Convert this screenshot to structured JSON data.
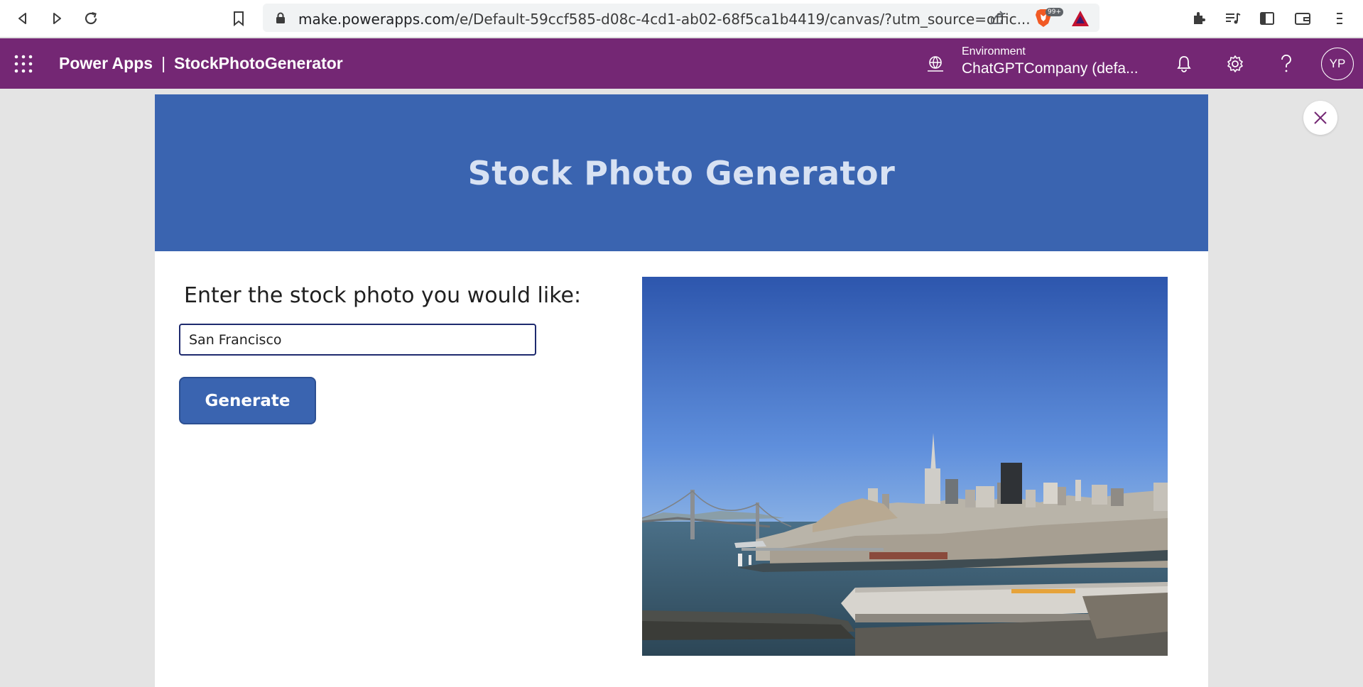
{
  "browser": {
    "url_host": "make.powerapps.com",
    "url_path": "/e/Default-59ccf585-d08c-4cd1-ab02-68f5ca1b4419/canvas/?utm_source=offic...",
    "extension_badge": "99+"
  },
  "app_header": {
    "product": "Power Apps",
    "separator": "|",
    "app_name": "StockPhotoGenerator",
    "environment_label": "Environment",
    "environment_value": "ChatGPTCompany (defa...",
    "avatar_initials": "YP"
  },
  "canvas": {
    "banner_title": "Stock Photo Generator",
    "prompt_label": "Enter the stock photo you would like:",
    "input_value": "San Francisco",
    "generate_label": "Generate"
  },
  "colors": {
    "header_purple": "#742774",
    "banner_blue": "#3a64b0",
    "input_border": "#1e2a6e"
  },
  "icons": [
    "back-icon",
    "forward-icon",
    "reload-icon",
    "bookmark-icon",
    "lock-icon",
    "share-icon",
    "brave-icon",
    "triangle-extension-icon",
    "extensions-icon",
    "playlist-icon",
    "sidebar-icon",
    "wallet-icon",
    "menu-icon",
    "waffle-icon",
    "environment-icon",
    "bell-icon",
    "gear-icon",
    "help-icon",
    "close-icon"
  ]
}
